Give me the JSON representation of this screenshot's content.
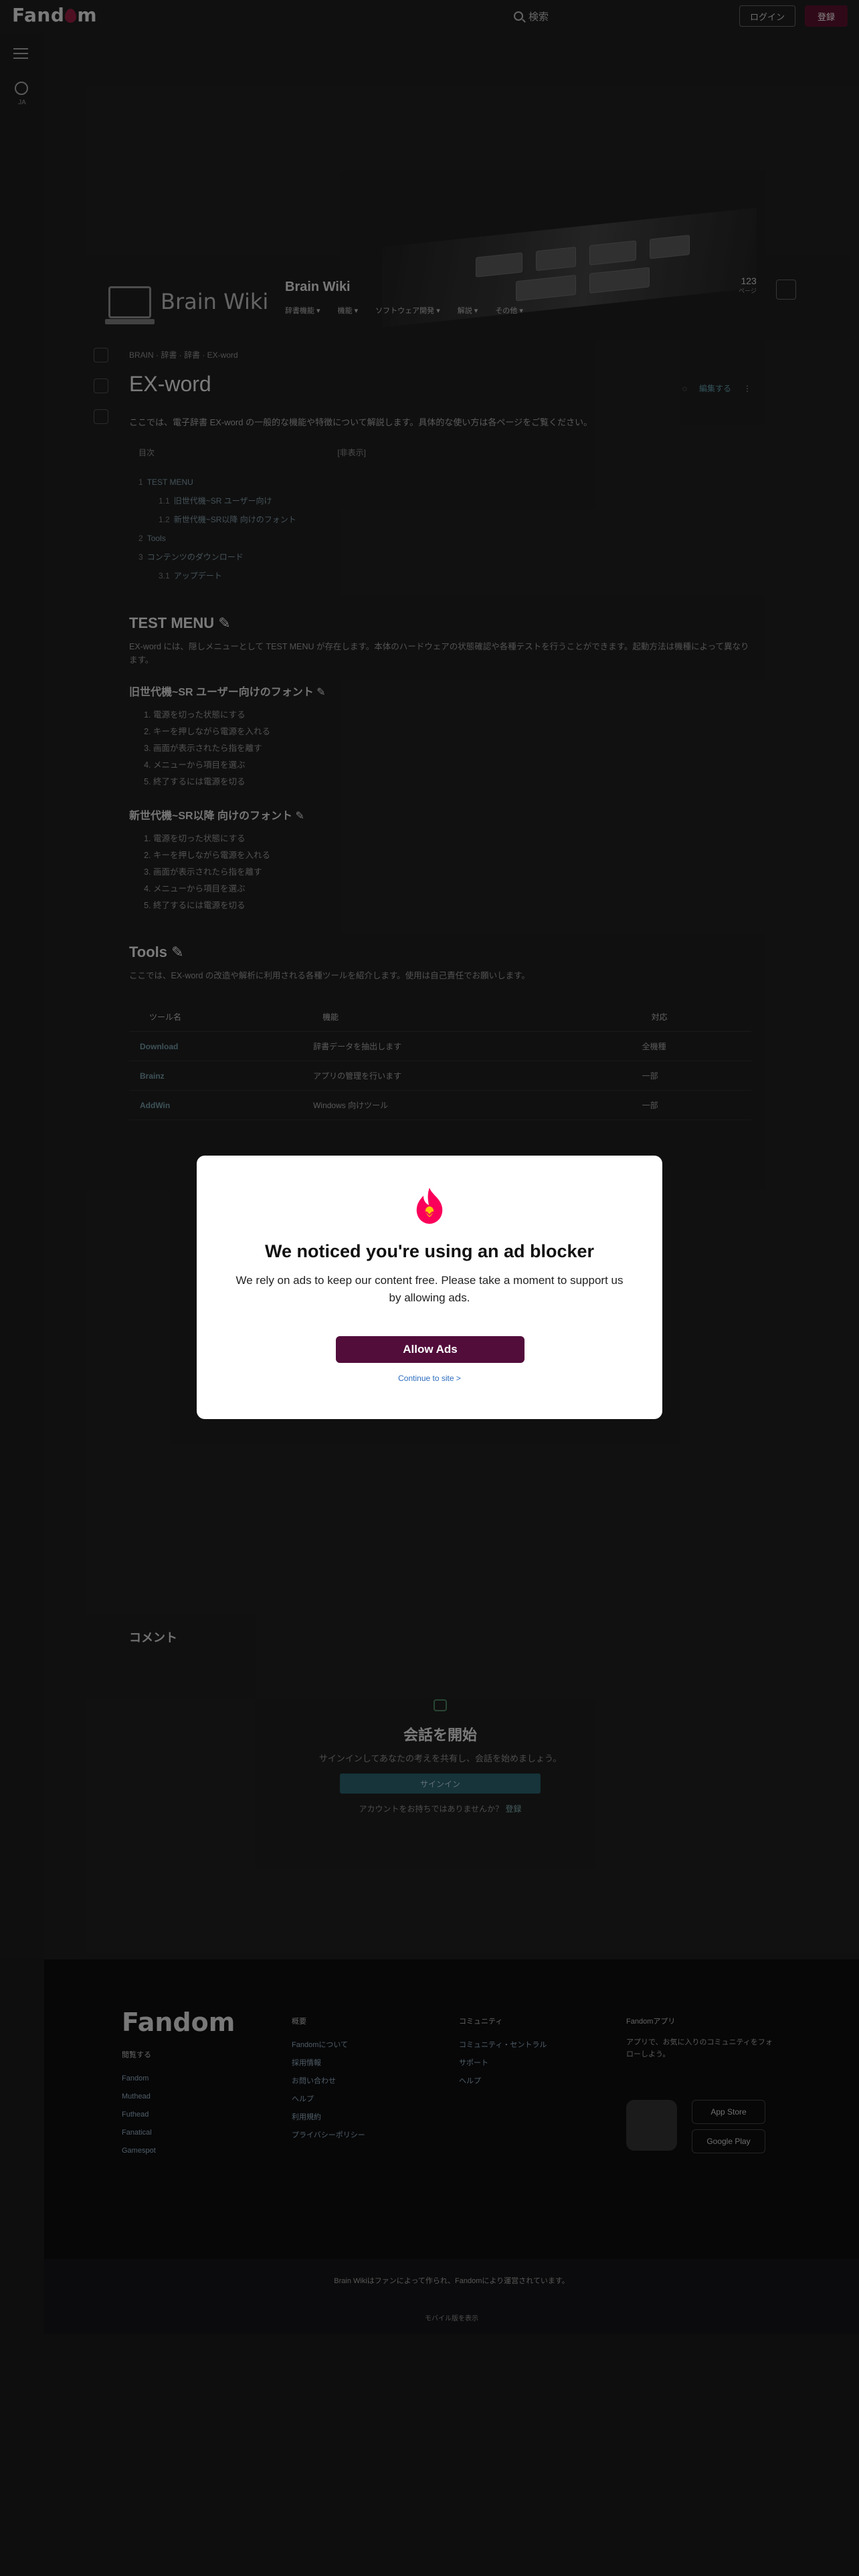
{
  "topbar": {
    "logo_text_a": "Fand",
    "logo_text_b": "m",
    "search_placeholder": "検索",
    "login_label": "ログイン",
    "register_label": "登録"
  },
  "rail": {
    "lang_label": "JA"
  },
  "wiki": {
    "brand": "Brain Wiki",
    "name": "Brain Wiki",
    "nav": [
      "辞書機能 ▾",
      "機能 ▾",
      "ソフトウェア開発 ▾",
      "解説 ▾",
      "その他 ▾"
    ],
    "page_count": "123",
    "page_count_label": "ページ"
  },
  "article": {
    "breadcrumb": "BRAIN · 辞書 · 辞書 · EX-word",
    "title": "EX-word",
    "edit_label": "編集する",
    "intro": "ここでは、電子辞書 EX-word の一般的な機能や特徴について解説します。具体的な使い方は各ページをご覧ください。",
    "toc_title": "目次",
    "toc_toggle": "[非表示]",
    "toc": [
      {
        "n": "1",
        "t": "TEST MENU",
        "sub": false
      },
      {
        "n": "1.1",
        "t": "旧世代機~SR ユーザー向け",
        "sub": true
      },
      {
        "n": "1.2",
        "t": "新世代機~SR以降 向けのフォント",
        "sub": true
      },
      {
        "n": "2",
        "t": "Tools",
        "sub": false
      },
      {
        "n": "3",
        "t": "コンテンツのダウンロード",
        "sub": false
      },
      {
        "n": "3.1",
        "t": "アップデート",
        "sub": true
      }
    ],
    "sections": {
      "test_menu": "TEST MENU",
      "test_menu_body": "EX-word には、隠しメニューとして TEST MENU が存在します。本体のハードウェアの状態確認や各種テストを行うことができます。起動方法は機種によって異なります。",
      "old_gen": "旧世代機~SR ユーザー向けのフォント",
      "old_steps": [
        "電源を切った状態にする",
        "キーを押しながら電源を入れる",
        "画面が表示されたら指を離す",
        "メニューから項目を選ぶ",
        "終了するには電源を切る"
      ],
      "new_gen": "新世代機~SR以降 向けのフォント",
      "new_steps": [
        "電源を切った状態にする",
        "キーを押しながら電源を入れる",
        "画面が表示されたら指を離す",
        "メニューから項目を選ぶ",
        "終了するには電源を切る"
      ],
      "tools": "Tools",
      "tools_body": "ここでは、EX-word の改造や解析に利用される各種ツールを紹介します。使用は自己責任でお願いします。",
      "tools_headers": [
        "ツール名",
        "機能",
        "対応"
      ],
      "tools_rows": [
        {
          "name": "Download",
          "desc": "辞書データを抽出します",
          "support": "全機種"
        },
        {
          "name": "Brainz",
          "desc": "アプリの管理を行います",
          "support": "一部"
        },
        {
          "name": "AddWin",
          "desc": "Windows 向けツール",
          "support": "一部"
        }
      ],
      "comments": "コメント"
    },
    "comments": {
      "heading": "会話を開始",
      "subtitle": "サインインしてあなたの考えを共有し、会話を始めましょう。",
      "button": "サインイン",
      "no_account_prefix": "アカウントをお持ちではありませんか？",
      "no_account_link": "登録"
    }
  },
  "footer": {
    "logo": "Fandom",
    "explore": {
      "head": "閲覧する",
      "items": [
        "Fandom",
        "Muthead",
        "Futhead",
        "Fanatical",
        "Gamespot"
      ]
    },
    "overview": {
      "head": "概要",
      "items": [
        "Fandomについて",
        "採用情報",
        "お問い合わせ",
        "ヘルプ",
        "利用規約",
        "プライバシーポリシー"
      ]
    },
    "community": {
      "head": "コミュニティ",
      "items": [
        "コミュニティ・セントラル",
        "サポート",
        "ヘルプ"
      ]
    },
    "apps": {
      "head": "Fandomアプリ",
      "body": "アプリで、お気に入りのコミュニティをフォローしよう。",
      "app_store": "App Store",
      "google_play": "Google Play"
    },
    "bottom_line1": "Brain Wikiはファンによって作られ、Fandomにより運営されています。",
    "bottom_line2": "モバイル版を表示"
  },
  "modal": {
    "title": "We noticed you're using an ad blocker",
    "body": "We rely on ads to keep our content free. Please take a moment to support us by allowing ads.",
    "allow_label": "Allow Ads",
    "continue_label": "Continue to site >",
    "brand_color": "#fa005a",
    "button_color": "#520d3b"
  }
}
